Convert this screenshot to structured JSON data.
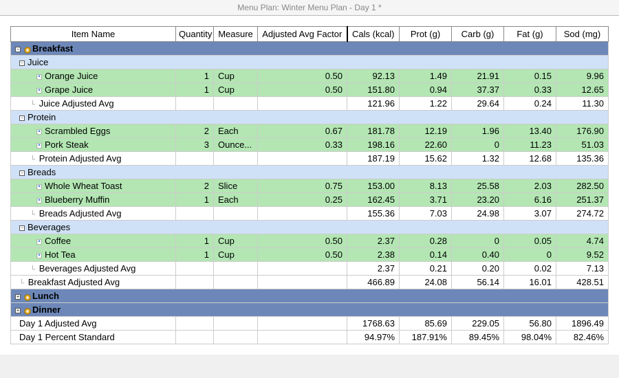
{
  "title": "Menu Plan: Winter Menu Plan - Day 1 *",
  "columns": [
    "Item Name",
    "Quantity",
    "Measure",
    "Adjusted Avg Factor",
    "Cals (kcal)",
    "Prot (g)",
    "Carb (g)",
    "Fat (g)",
    "Sod (mg)"
  ],
  "meals": [
    {
      "name": "Breakfast",
      "groups": [
        {
          "name": "Juice",
          "items": [
            {
              "name": "Orange Juice",
              "qty": "1",
              "measure": "Cup",
              "factor": "0.50",
              "n": [
                "92.13",
                "1.49",
                "21.91",
                "0.15",
                "9.96"
              ]
            },
            {
              "name": "Grape Juice",
              "qty": "1",
              "measure": "Cup",
              "factor": "0.50",
              "n": [
                "151.80",
                "0.94",
                "37.37",
                "0.33",
                "12.65"
              ]
            }
          ],
          "avg": {
            "label": "Juice Adjusted Avg",
            "n": [
              "121.96",
              "1.22",
              "29.64",
              "0.24",
              "11.30"
            ]
          }
        },
        {
          "name": "Protein",
          "items": [
            {
              "name": "Scrambled Eggs",
              "qty": "2",
              "measure": "Each",
              "factor": "0.67",
              "n": [
                "181.78",
                "12.19",
                "1.96",
                "13.40",
                "176.90"
              ]
            },
            {
              "name": "Pork Steak",
              "qty": "3",
              "measure": "Ounce...",
              "factor": "0.33",
              "n": [
                "198.16",
                "22.60",
                "0",
                "11.23",
                "51.03"
              ]
            }
          ],
          "avg": {
            "label": "Protein Adjusted Avg",
            "n": [
              "187.19",
              "15.62",
              "1.32",
              "12.68",
              "135.36"
            ]
          }
        },
        {
          "name": "Breads",
          "items": [
            {
              "name": "Whole Wheat Toast",
              "qty": "2",
              "measure": "Slice",
              "factor": "0.75",
              "n": [
                "153.00",
                "8.13",
                "25.58",
                "2.03",
                "282.50"
              ]
            },
            {
              "name": "Blueberry Muffin",
              "qty": "1",
              "measure": "Each",
              "factor": "0.25",
              "n": [
                "162.45",
                "3.71",
                "23.20",
                "6.16",
                "251.37"
              ]
            }
          ],
          "avg": {
            "label": "Breads Adjusted Avg",
            "n": [
              "155.36",
              "7.03",
              "24.98",
              "3.07",
              "274.72"
            ]
          }
        },
        {
          "name": "Beverages",
          "items": [
            {
              "name": "Coffee",
              "qty": "1",
              "measure": "Cup",
              "factor": "0.50",
              "n": [
                "2.37",
                "0.28",
                "0",
                "0.05",
                "4.74"
              ]
            },
            {
              "name": "Hot Tea",
              "qty": "1",
              "measure": "Cup",
              "factor": "0.50",
              "n": [
                "2.38",
                "0.14",
                "0.40",
                "0",
                "9.52"
              ]
            }
          ],
          "avg": {
            "label": "Beverages Adjusted Avg",
            "n": [
              "2.37",
              "0.21",
              "0.20",
              "0.02",
              "7.13"
            ]
          }
        }
      ],
      "meal_avg": {
        "label": "Breakfast Adjusted Avg",
        "n": [
          "466.89",
          "24.08",
          "56.14",
          "16.01",
          "428.51"
        ]
      }
    },
    {
      "name": "Lunch",
      "groups": [],
      "meal_avg": null
    },
    {
      "name": "Dinner",
      "groups": [],
      "meal_avg": null
    }
  ],
  "totals": [
    {
      "label": "Day 1 Adjusted Avg",
      "n": [
        "1768.63",
        "85.69",
        "229.05",
        "56.80",
        "1896.49"
      ]
    },
    {
      "label": "Day 1 Percent Standard",
      "n": [
        "94.97%",
        "187.91%",
        "89.45%",
        "98.04%",
        "82.46%"
      ]
    }
  ]
}
